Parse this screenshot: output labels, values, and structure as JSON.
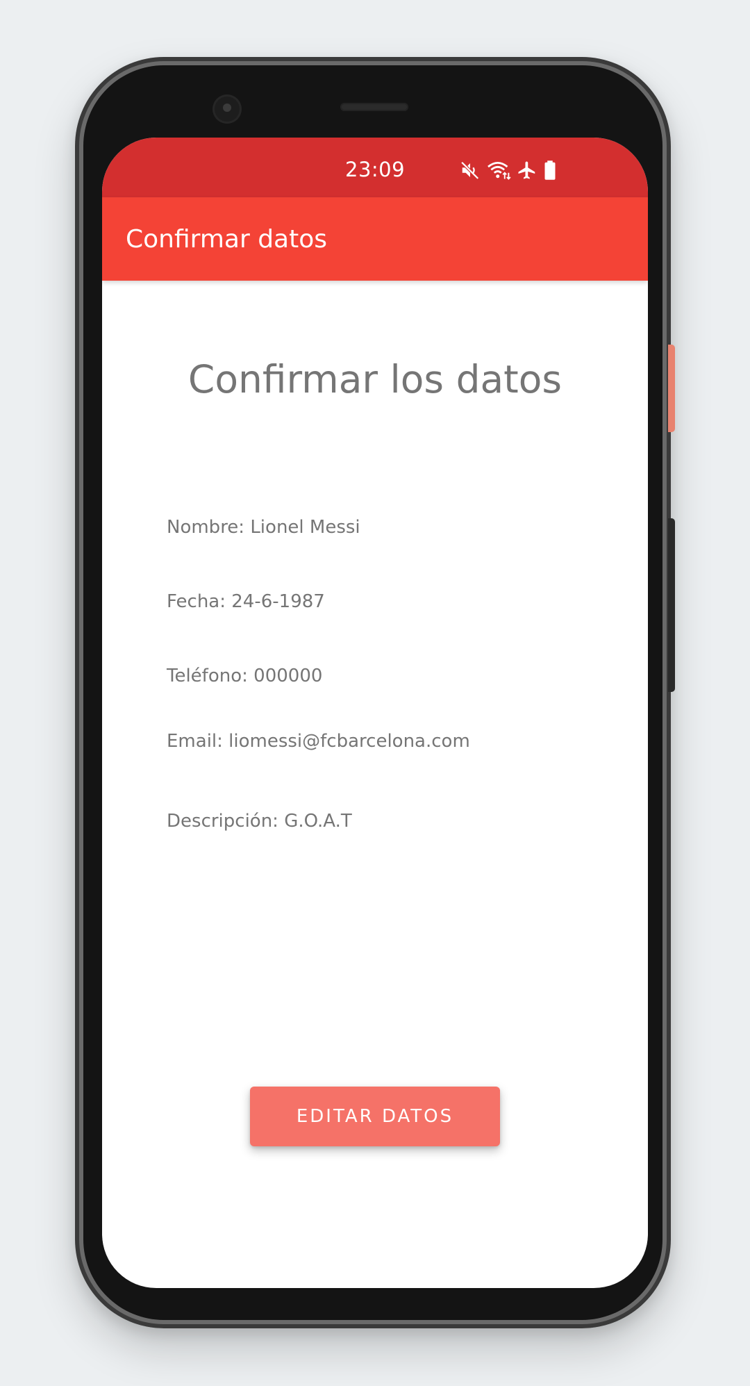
{
  "status_bar": {
    "time": "23:09",
    "icons": [
      "mute-icon",
      "wifi-icon",
      "airplane-icon",
      "battery-icon"
    ],
    "color": "#D32F2F"
  },
  "app_bar": {
    "title": "Confirmar datos",
    "color": "#F44336"
  },
  "content": {
    "heading": "Confirmar los datos",
    "fields": {
      "nombre": "Nombre: Lionel Messi",
      "fecha": "Fecha: 24-6-1987",
      "telefono": "Teléfono: 000000",
      "email": "Email: liomessi@fcbarcelona.com",
      "descripcion": "Descripción: G.O.A.T"
    }
  },
  "button": {
    "label": "EDITAR DATOS",
    "color": "#F57268"
  }
}
